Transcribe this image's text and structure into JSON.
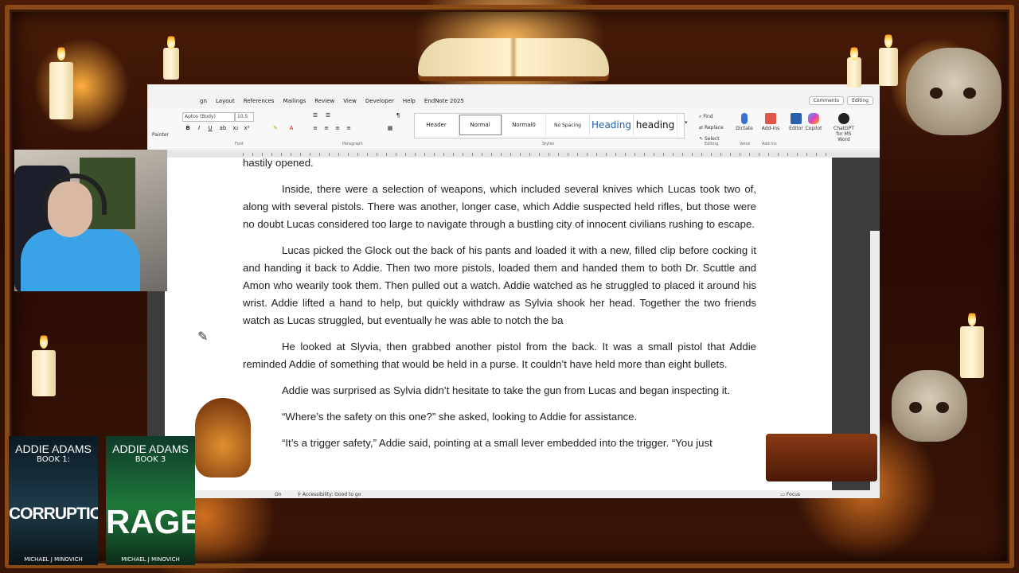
{
  "menu": {
    "items": [
      "gn",
      "Layout",
      "References",
      "Mailings",
      "Review",
      "View",
      "Developer",
      "Help",
      "EndNote 2025"
    ],
    "comments_label": "Comments",
    "editing_label": "Editing"
  },
  "ribbon": {
    "font_name": "Aptos (Body)",
    "font_size": "10.5",
    "painter_label": "Painter",
    "font_group": "Font",
    "paragraph_group": "Paragraph",
    "styles_group": "Styles",
    "editing_group": "Editing",
    "voice_group": "Voice",
    "addins_group": "Add-ins",
    "styles": [
      "Header",
      "Normal",
      "Normal0",
      "No Spacing",
      "Heading",
      "heading"
    ],
    "find_label": "Find",
    "replace_label": "Replace",
    "select_label": "Select",
    "dictate_label": "Dictate",
    "addins_label": "Add-ins",
    "editor_label": "Editor",
    "copilot_label": "Copilot",
    "chatgpt_label": "ChatGPT for MS Word"
  },
  "document": {
    "paragraphs": [
      "hastily opened.",
      "Inside, there were a selection of weapons, which included several knives which Lucas took two of, along with several pistols. There was another, longer case, which Addie suspected held rifles, but those were no doubt Lucas considered too large to navigate through a bustling city of innocent civilians rushing to escape.",
      "Lucas picked the Glock out the back of his pants and loaded it with a new, filled clip before cocking it and handing it back to Addie. Then two more pistols, loaded them and handed them to both Dr. Scuttle and Amon who wearily took them. Then pulled out a watch. Addie watched as he struggled to placed it around his wrist. Addie lifted a hand to help, but quickly withdraw as Sylvia shook her head. Together the two friends watch as Lucas struggled, but eventually he was able to notch the ba",
      "He looked at Slyvia, then grabbed another pistol from the back. It was a small pistol that Addie reminded Addie of something that would be held in a purse. It couldn’t have held more than eight bullets.",
      "Addie was surprised as Sylvia didn’t hesitate to take the gun from Lucas and began inspecting it.",
      "“Where’s the safety on this one?” she asked, looking to Addie for assistance.",
      "“It’s a trigger safety,” Addie said, pointing at a small lever embedded into the trigger. “You just"
    ]
  },
  "status": {
    "left": "On",
    "accessibility": "Accessibility: Good to go",
    "focus": "Focus"
  },
  "covers": [
    {
      "series": "ADDIE ADAMS",
      "book": "BOOK 1:",
      "title": "CORRUPTION",
      "author": "MICHAEL J MINOVICH"
    },
    {
      "series": "ADDIE ADAMS",
      "book": "BOOK 3",
      "title": "RAGE",
      "author": "MICHAEL J MINOVICH"
    }
  ]
}
